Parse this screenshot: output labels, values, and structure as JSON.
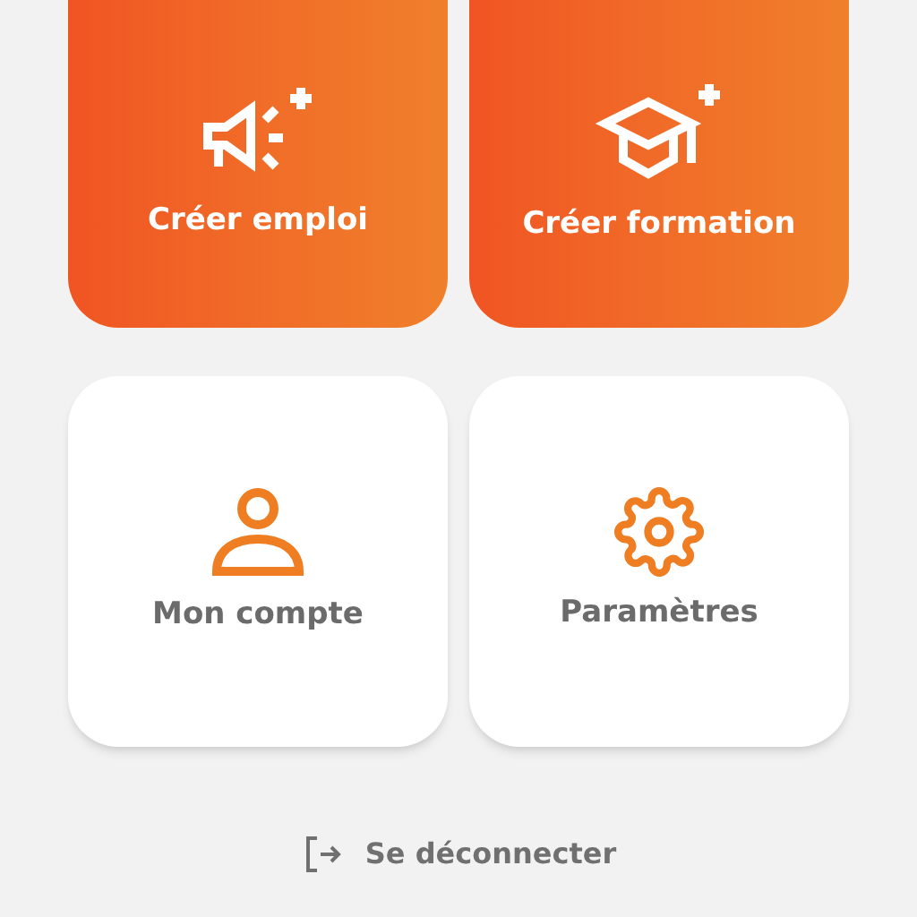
{
  "tiles": [
    {
      "label": "Créer emploi",
      "kind": "primary"
    },
    {
      "label": "Créer formation",
      "kind": "primary"
    },
    {
      "label": "Mon compte",
      "kind": "plain"
    },
    {
      "label": "Paramètres",
      "kind": "plain"
    }
  ],
  "logout": {
    "label": "Se déconnecter"
  }
}
